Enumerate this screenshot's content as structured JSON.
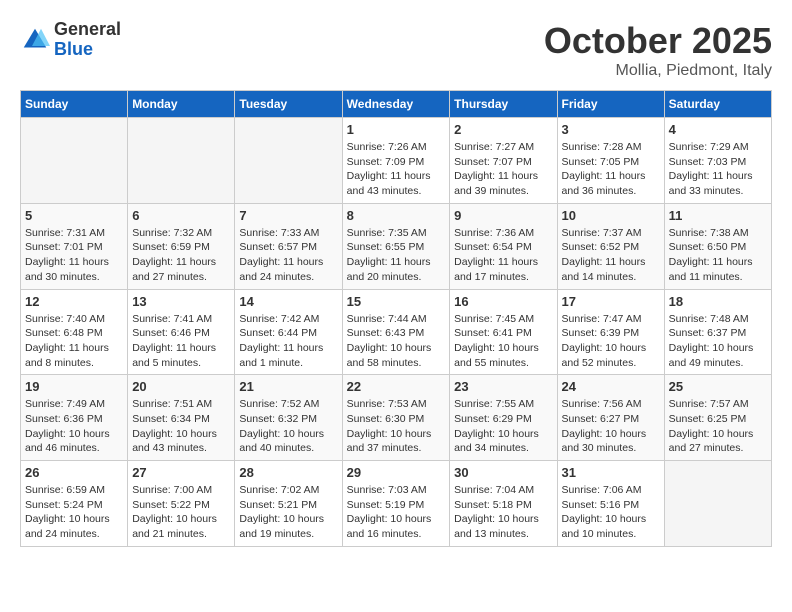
{
  "header": {
    "logo": {
      "general": "General",
      "blue": "Blue"
    },
    "title": "October 2025",
    "location": "Mollia, Piedmont, Italy"
  },
  "days_of_week": [
    "Sunday",
    "Monday",
    "Tuesday",
    "Wednesday",
    "Thursday",
    "Friday",
    "Saturday"
  ],
  "weeks": [
    [
      {
        "day": "",
        "info": ""
      },
      {
        "day": "",
        "info": ""
      },
      {
        "day": "",
        "info": ""
      },
      {
        "day": "1",
        "info": "Sunrise: 7:26 AM\nSunset: 7:09 PM\nDaylight: 11 hours and 43 minutes."
      },
      {
        "day": "2",
        "info": "Sunrise: 7:27 AM\nSunset: 7:07 PM\nDaylight: 11 hours and 39 minutes."
      },
      {
        "day": "3",
        "info": "Sunrise: 7:28 AM\nSunset: 7:05 PM\nDaylight: 11 hours and 36 minutes."
      },
      {
        "day": "4",
        "info": "Sunrise: 7:29 AM\nSunset: 7:03 PM\nDaylight: 11 hours and 33 minutes."
      }
    ],
    [
      {
        "day": "5",
        "info": "Sunrise: 7:31 AM\nSunset: 7:01 PM\nDaylight: 11 hours and 30 minutes."
      },
      {
        "day": "6",
        "info": "Sunrise: 7:32 AM\nSunset: 6:59 PM\nDaylight: 11 hours and 27 minutes."
      },
      {
        "day": "7",
        "info": "Sunrise: 7:33 AM\nSunset: 6:57 PM\nDaylight: 11 hours and 24 minutes."
      },
      {
        "day": "8",
        "info": "Sunrise: 7:35 AM\nSunset: 6:55 PM\nDaylight: 11 hours and 20 minutes."
      },
      {
        "day": "9",
        "info": "Sunrise: 7:36 AM\nSunset: 6:54 PM\nDaylight: 11 hours and 17 minutes."
      },
      {
        "day": "10",
        "info": "Sunrise: 7:37 AM\nSunset: 6:52 PM\nDaylight: 11 hours and 14 minutes."
      },
      {
        "day": "11",
        "info": "Sunrise: 7:38 AM\nSunset: 6:50 PM\nDaylight: 11 hours and 11 minutes."
      }
    ],
    [
      {
        "day": "12",
        "info": "Sunrise: 7:40 AM\nSunset: 6:48 PM\nDaylight: 11 hours and 8 minutes."
      },
      {
        "day": "13",
        "info": "Sunrise: 7:41 AM\nSunset: 6:46 PM\nDaylight: 11 hours and 5 minutes."
      },
      {
        "day": "14",
        "info": "Sunrise: 7:42 AM\nSunset: 6:44 PM\nDaylight: 11 hours and 1 minute."
      },
      {
        "day": "15",
        "info": "Sunrise: 7:44 AM\nSunset: 6:43 PM\nDaylight: 10 hours and 58 minutes."
      },
      {
        "day": "16",
        "info": "Sunrise: 7:45 AM\nSunset: 6:41 PM\nDaylight: 10 hours and 55 minutes."
      },
      {
        "day": "17",
        "info": "Sunrise: 7:47 AM\nSunset: 6:39 PM\nDaylight: 10 hours and 52 minutes."
      },
      {
        "day": "18",
        "info": "Sunrise: 7:48 AM\nSunset: 6:37 PM\nDaylight: 10 hours and 49 minutes."
      }
    ],
    [
      {
        "day": "19",
        "info": "Sunrise: 7:49 AM\nSunset: 6:36 PM\nDaylight: 10 hours and 46 minutes."
      },
      {
        "day": "20",
        "info": "Sunrise: 7:51 AM\nSunset: 6:34 PM\nDaylight: 10 hours and 43 minutes."
      },
      {
        "day": "21",
        "info": "Sunrise: 7:52 AM\nSunset: 6:32 PM\nDaylight: 10 hours and 40 minutes."
      },
      {
        "day": "22",
        "info": "Sunrise: 7:53 AM\nSunset: 6:30 PM\nDaylight: 10 hours and 37 minutes."
      },
      {
        "day": "23",
        "info": "Sunrise: 7:55 AM\nSunset: 6:29 PM\nDaylight: 10 hours and 34 minutes."
      },
      {
        "day": "24",
        "info": "Sunrise: 7:56 AM\nSunset: 6:27 PM\nDaylight: 10 hours and 30 minutes."
      },
      {
        "day": "25",
        "info": "Sunrise: 7:57 AM\nSunset: 6:25 PM\nDaylight: 10 hours and 27 minutes."
      }
    ],
    [
      {
        "day": "26",
        "info": "Sunrise: 6:59 AM\nSunset: 5:24 PM\nDaylight: 10 hours and 24 minutes."
      },
      {
        "day": "27",
        "info": "Sunrise: 7:00 AM\nSunset: 5:22 PM\nDaylight: 10 hours and 21 minutes."
      },
      {
        "day": "28",
        "info": "Sunrise: 7:02 AM\nSunset: 5:21 PM\nDaylight: 10 hours and 19 minutes."
      },
      {
        "day": "29",
        "info": "Sunrise: 7:03 AM\nSunset: 5:19 PM\nDaylight: 10 hours and 16 minutes."
      },
      {
        "day": "30",
        "info": "Sunrise: 7:04 AM\nSunset: 5:18 PM\nDaylight: 10 hours and 13 minutes."
      },
      {
        "day": "31",
        "info": "Sunrise: 7:06 AM\nSunset: 5:16 PM\nDaylight: 10 hours and 10 minutes."
      },
      {
        "day": "",
        "info": ""
      }
    ]
  ]
}
